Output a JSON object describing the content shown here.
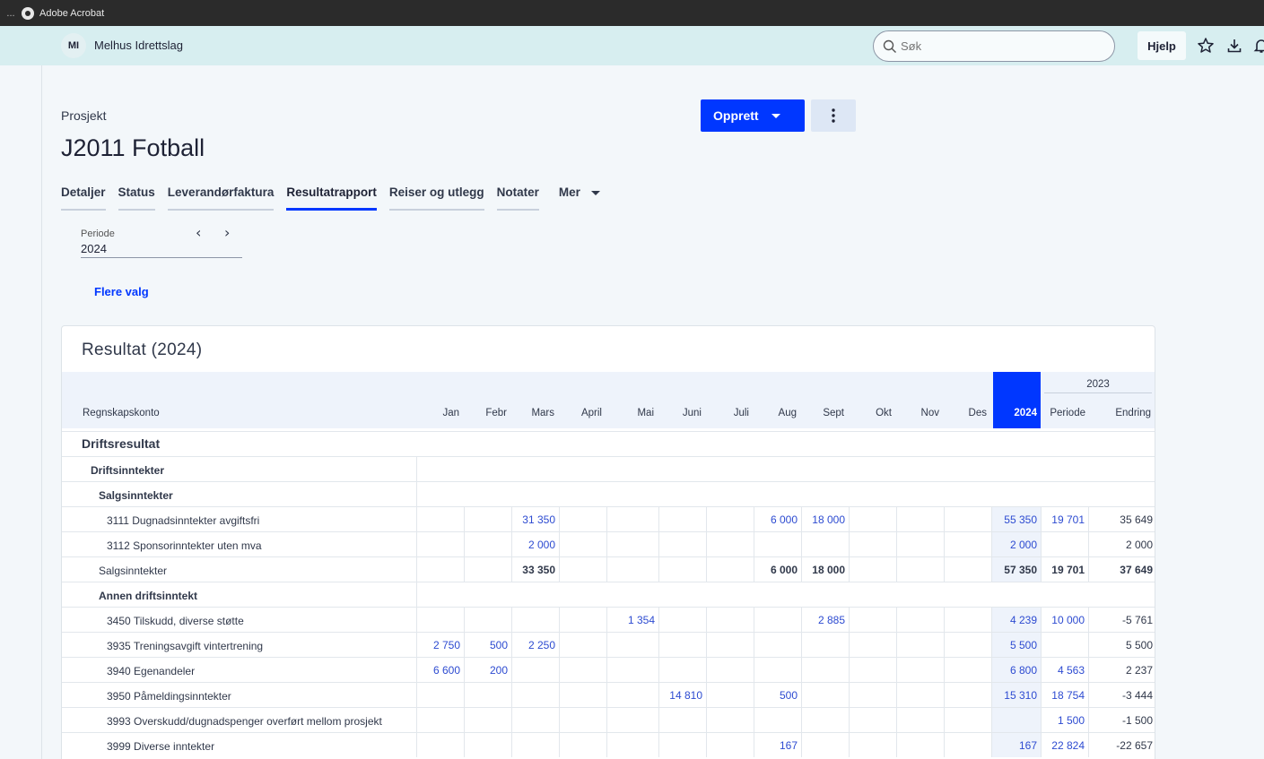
{
  "os": {
    "app_name": "Adobe Acrobat",
    "dots": "..."
  },
  "header": {
    "avatar_initials": "MI",
    "org_name": "Melhus Idrettslag",
    "search_placeholder": "Søk",
    "help_label": "Hjelp"
  },
  "page": {
    "breadcrumb": "Prosjekt",
    "title": "J2011 Fotball",
    "create_label": "Opprett"
  },
  "tabs": [
    "Detaljer",
    "Status",
    "Leverandørfaktura",
    "Resultatrapport",
    "Reiser og utlegg",
    "Notater"
  ],
  "tabs_more": "Mer",
  "active_tab": "Resultatrapport",
  "period": {
    "label": "Periode",
    "value": "2024"
  },
  "more_options": "Flere valg",
  "report": {
    "title": "Resultat (2024)",
    "account_header": "Regnskapskonto",
    "months": [
      "Jan",
      "Febr",
      "Mars",
      "April",
      "Mai",
      "Juni",
      "Juli",
      "Aug",
      "Sept",
      "Okt",
      "Nov",
      "Des"
    ],
    "current_year_header": "2024",
    "prev_year_label": "2023",
    "period_header": "Periode",
    "change_header": "Endring",
    "rows": [
      {
        "type": "section",
        "label": "Driftsresultat"
      },
      {
        "type": "group",
        "label": "Driftsinntekter",
        "indent": 1
      },
      {
        "type": "group",
        "label": "Salgsinntekter",
        "indent": 2
      },
      {
        "type": "data",
        "label": "3111 Dugnadsinntekter avgiftsfri",
        "months": [
          "",
          "",
          "31 350",
          "",
          "",
          "",
          "",
          "6 000",
          "18 000",
          "",
          "",
          ""
        ],
        "y2024": "55 350",
        "period": "19 701",
        "change": "35 649"
      },
      {
        "type": "data",
        "label": "3112 Sponsorinntekter uten mva",
        "months": [
          "",
          "",
          "2 000",
          "",
          "",
          "",
          "",
          "",
          "",
          "",
          "",
          ""
        ],
        "y2024": "2 000",
        "period": "",
        "change": "2 000"
      },
      {
        "type": "sum",
        "label": "Salgsinntekter",
        "months": [
          "",
          "",
          "33 350",
          "",
          "",
          "",
          "",
          "6 000",
          "18 000",
          "",
          "",
          ""
        ],
        "y2024": "57 350",
        "period": "19 701",
        "change": "37 649"
      },
      {
        "type": "group",
        "label": "Annen driftsinntekt",
        "indent": 2
      },
      {
        "type": "data",
        "label": "3450 Tilskudd, diverse støtte",
        "months": [
          "",
          "",
          "",
          "",
          "1 354",
          "",
          "",
          "",
          "2 885",
          "",
          "",
          ""
        ],
        "y2024": "4 239",
        "period": "10 000",
        "change": "-5 761"
      },
      {
        "type": "data",
        "label": "3935 Treningsavgift vintertrening",
        "months": [
          "2 750",
          "500",
          "2 250",
          "",
          "",
          "",
          "",
          "",
          "",
          "",
          "",
          ""
        ],
        "y2024": "5 500",
        "period": "",
        "change": "5 500"
      },
      {
        "type": "data",
        "label": "3940 Egenandeler",
        "months": [
          "6 600",
          "200",
          "",
          "",
          "",
          "",
          "",
          "",
          "",
          "",
          "",
          ""
        ],
        "y2024": "6 800",
        "period": "4 563",
        "change": "2 237"
      },
      {
        "type": "data",
        "label": "3950 Påmeldingsinntekter",
        "months": [
          "",
          "",
          "",
          "",
          "",
          "14 810",
          "",
          "500",
          "",
          "",
          "",
          ""
        ],
        "y2024": "15 310",
        "period": "18 754",
        "change": "-3 444"
      },
      {
        "type": "data",
        "label": "3993 Overskudd/dugnadspenger overført mellom prosjekt",
        "months": [
          "",
          "",
          "",
          "",
          "",
          "",
          "",
          "",
          "",
          "",
          "",
          ""
        ],
        "y2024": "",
        "period": "1 500",
        "change": "-1 500"
      },
      {
        "type": "data",
        "label": "3999 Diverse inntekter",
        "months": [
          "",
          "",
          "",
          "",
          "",
          "",
          "",
          "167",
          "",
          "",
          "",
          ""
        ],
        "y2024": "167",
        "period": "22 824",
        "change": "-22 657"
      }
    ]
  },
  "colors": {
    "accent": "#0037ff",
    "header_bg": "#d7eef0",
    "link": "#2d4bd1"
  },
  "icons": [
    "globe-icon",
    "search-icon",
    "star-icon",
    "download-icon",
    "bell-icon",
    "chevron-left-icon",
    "chevron-right-icon",
    "kebab-icon"
  ]
}
